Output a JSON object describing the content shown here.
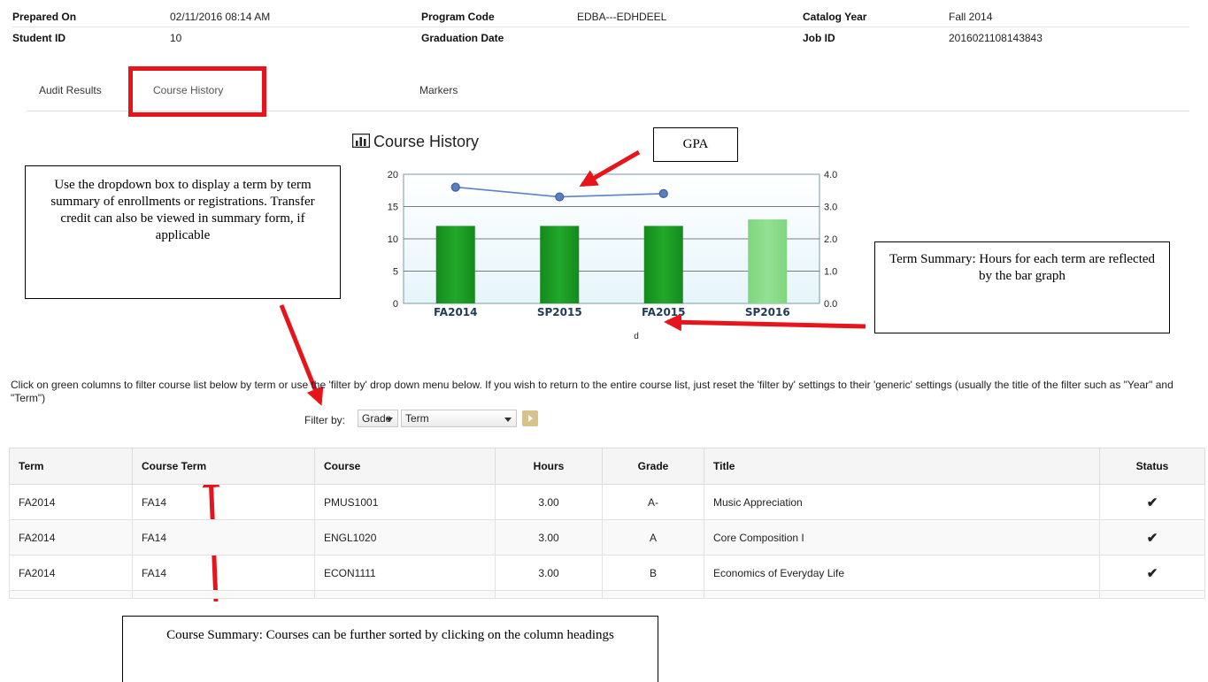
{
  "header": {
    "row1": [
      {
        "label": "Prepared On",
        "value": "02/11/2016 08:14 AM"
      },
      {
        "label": "Program Code",
        "value": "EDBA---EDHDEEL"
      },
      {
        "label": "Catalog Year",
        "value": "Fall 2014"
      }
    ],
    "row2": [
      {
        "label": "Student ID",
        "value": "10"
      },
      {
        "label": "Graduation Date",
        "value": ""
      },
      {
        "label": "Job ID",
        "value": "2016021108143843"
      }
    ]
  },
  "tabs": [
    {
      "label": "Audit Results"
    },
    {
      "label": "Course History",
      "active": true
    },
    {
      "label": "Markers"
    }
  ],
  "chart_title": "Course History",
  "chart_data": {
    "type": "bar",
    "categories": [
      "FA2014",
      "SP2015",
      "FA2015",
      "SP2016"
    ],
    "series": [
      {
        "values": [
          12,
          12,
          12,
          13
        ]
      },
      {
        "values": [
          3.6,
          3.3,
          3.4,
          null
        ]
      }
    ],
    "xlabel": "d",
    "ylim": [
      0,
      20
    ],
    "y_ticks": [
      "20",
      "15",
      "10",
      "5",
      "0"
    ],
    "y2lim": [
      0.0,
      4.0
    ],
    "y2_ticks": [
      "4.0",
      "3.0",
      "2.0",
      "1.0",
      "0.0"
    ],
    "grid": true,
    "colors": {
      "bar": "#22a82a",
      "bar_future": "#93e093",
      "line": "#5b83c6",
      "point": "#3d5f9e",
      "plot_bg": "#e6f5fb"
    }
  },
  "callouts": {
    "gpa": "GPA",
    "dropdown": "Use the dropdown box to display a term by term summary of enrollments or registrations. Transfer credit can also be viewed in summary form, if applicable",
    "term_summary": "Term Summary: Hours for each term are reflected by the bar graph",
    "course_summary": "Course Summary: Courses can be further sorted by clicking on the column headings"
  },
  "instructions": "Click on green columns to filter course list below by term or use the 'filter by' drop down menu below. If you wish to return to the entire course list, just reset the 'filter by' settings to their 'generic' settings (usually the title of the filter such as \"Year\" and \"Term\")",
  "filter": {
    "label": "Filter by:",
    "grade_select": "Grade",
    "term_select": "Term"
  },
  "table": {
    "headers": [
      "Term",
      "Course Term",
      "Course",
      "Hours",
      "Grade",
      "Title",
      "Status"
    ],
    "rows": [
      {
        "term": "FA2014",
        "course_term": "FA14",
        "course": "PMUS1001",
        "hours": "3.00",
        "grade": "A-",
        "title": "Music Appreciation",
        "status": "✔"
      },
      {
        "term": "FA2014",
        "course_term": "FA14",
        "course": "ENGL1020",
        "hours": "3.00",
        "grade": "A",
        "title": "Core Composition I",
        "status": "✔"
      },
      {
        "term": "FA2014",
        "course_term": "FA14",
        "course": "ECON1111",
        "hours": "3.00",
        "grade": "B",
        "title": "Economics of Everyday Life",
        "status": "✔"
      }
    ]
  },
  "colors": {
    "highlight": "#e8141b",
    "arrow": "#e8141b",
    "status_check": "#2f8a1e"
  }
}
